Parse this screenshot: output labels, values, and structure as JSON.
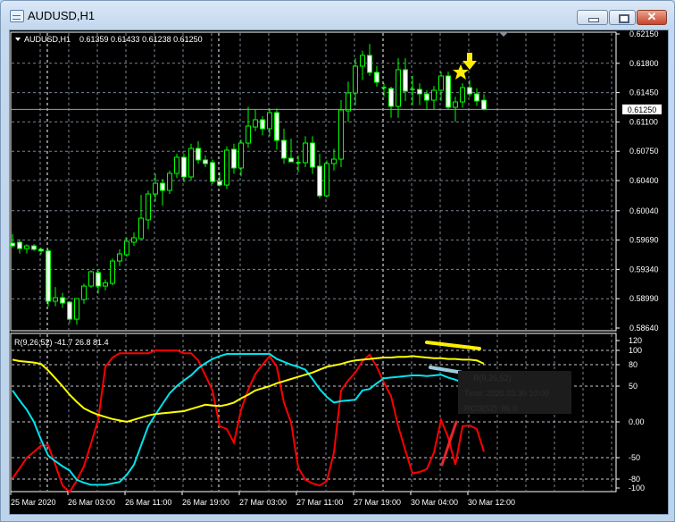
{
  "window": {
    "title": "AUDUSD,H1",
    "buttons": {
      "minimize": "minimize",
      "maximize": "maximize",
      "close": "✕"
    }
  },
  "header": {
    "symbol": "AUDUSD,H1",
    "ohlc": "0.61359 0.61433 0.61238 0.61250"
  },
  "colors": {
    "background": "#000000",
    "candle_outline": "#00ff00",
    "bull_fill": "#000000",
    "bear_fill": "#ffffff",
    "grid": "#7a8494",
    "rci_short": "#ff0000",
    "rci_mid": "#00e5ee",
    "rci_long": "#ffff00"
  },
  "price_axis": {
    "labels": [
      "0.62150",
      "0.61800",
      "0.61450",
      "0.61100",
      "0.60750",
      "0.60400",
      "0.60040",
      "0.59690",
      "0.59340",
      "0.58990",
      "0.58640"
    ],
    "current_price": "0.61250"
  },
  "time_axis": {
    "labels": [
      "25 Mar 2020",
      "26 Mar 03:00",
      "26 Mar 11:00",
      "26 Mar 19:00",
      "27 Mar 03:00",
      "27 Mar 11:00",
      "27 Mar 19:00",
      "30 Mar 04:00",
      "30 Mar 12:00"
    ]
  },
  "indicator": {
    "label": "R(9,26,52) -41.7 26.8 81.4",
    "levels": [
      "120",
      "100",
      "80",
      "50",
      "0.00",
      "-50",
      "-80",
      "-100"
    ],
    "tooltip": [
      "R(9,26,52)",
      "Time: 2020.03.30 10:00",
      "RCI3(52): 86.0"
    ]
  },
  "chart_data": {
    "type": "candlestick",
    "symbol": "AUDUSD",
    "timeframe": "H1",
    "ylim": [
      0.5864,
      0.6215
    ],
    "ohlc": [
      [
        0.59653,
        0.5976,
        0.596,
        0.59621
      ],
      [
        0.59664,
        0.597,
        0.5953,
        0.59589
      ],
      [
        0.59589,
        0.5964,
        0.5953,
        0.59621
      ],
      [
        0.59621,
        0.5964,
        0.5956,
        0.59579
      ],
      [
        0.59579,
        0.596,
        0.5952,
        0.5956
      ],
      [
        0.5956,
        0.5958,
        0.589,
        0.5896
      ],
      [
        0.5896,
        0.5913,
        0.589,
        0.59002
      ],
      [
        0.59002,
        0.5906,
        0.5888,
        0.58938
      ],
      [
        0.58949,
        0.5896,
        0.587,
        0.58746
      ],
      [
        0.58746,
        0.5898,
        0.5868,
        0.58992
      ],
      [
        0.58981,
        0.5917,
        0.5893,
        0.59141
      ],
      [
        0.59141,
        0.5933,
        0.5912,
        0.59312
      ],
      [
        0.59301,
        0.5933,
        0.5905,
        0.59141
      ],
      [
        0.59141,
        0.5922,
        0.5909,
        0.5918
      ],
      [
        0.59173,
        0.5947,
        0.5915,
        0.5944
      ],
      [
        0.5944,
        0.5958,
        0.5938,
        0.59525
      ],
      [
        0.59515,
        0.5972,
        0.5949,
        0.59675
      ],
      [
        0.59664,
        0.5978,
        0.5962,
        0.59717
      ],
      [
        0.59707,
        0.6023,
        0.597,
        0.59952
      ],
      [
        0.59931,
        0.6028,
        0.5982,
        0.6024
      ],
      [
        0.6024,
        0.6048,
        0.6015,
        0.60368
      ],
      [
        0.60368,
        0.6042,
        0.601,
        0.60283
      ],
      [
        0.60283,
        0.6052,
        0.6024,
        0.60486
      ],
      [
        0.60486,
        0.6072,
        0.6043,
        0.60678
      ],
      [
        0.60678,
        0.6072,
        0.6038,
        0.60443
      ],
      [
        0.60443,
        0.6084,
        0.604,
        0.60784
      ],
      [
        0.60784,
        0.6087,
        0.606,
        0.60646
      ],
      [
        0.60646,
        0.607,
        0.6056,
        0.60603
      ],
      [
        0.60614,
        0.6065,
        0.6036,
        0.60389
      ],
      [
        0.60389,
        0.605,
        0.6033,
        0.60347
      ],
      [
        0.60347,
        0.6081,
        0.603,
        0.60763
      ],
      [
        0.60774,
        0.6084,
        0.6048,
        0.6055
      ],
      [
        0.6055,
        0.6089,
        0.6045,
        0.60848
      ],
      [
        0.60848,
        0.6128,
        0.6079,
        0.61051
      ],
      [
        0.6104,
        0.6125,
        0.6099,
        0.61126
      ],
      [
        0.61126,
        0.6117,
        0.6094,
        0.61019
      ],
      [
        0.61019,
        0.6126,
        0.6093,
        0.61211
      ],
      [
        0.61211,
        0.6126,
        0.6077,
        0.6088
      ],
      [
        0.6088,
        0.6102,
        0.606,
        0.60667
      ],
      [
        0.60667,
        0.609,
        0.6062,
        0.60624
      ],
      [
        0.60614,
        0.607,
        0.605,
        0.60614
      ],
      [
        0.60614,
        0.6093,
        0.6056,
        0.60848
      ],
      [
        0.60848,
        0.6093,
        0.6048,
        0.6056
      ],
      [
        0.60571,
        0.6072,
        0.6019,
        0.60219
      ],
      [
        0.60219,
        0.6064,
        0.602,
        0.60603
      ],
      [
        0.60603,
        0.6078,
        0.6052,
        0.60656
      ],
      [
        0.60656,
        0.6136,
        0.6056,
        0.61243
      ],
      [
        0.61232,
        0.6158,
        0.611,
        0.61446
      ],
      [
        0.61446,
        0.6186,
        0.613,
        0.61766
      ],
      [
        0.61766,
        0.6195,
        0.616,
        0.61894
      ],
      [
        0.61894,
        0.6203,
        0.6165,
        0.61691
      ],
      [
        0.61691,
        0.6177,
        0.6152,
        0.61574
      ],
      [
        0.6151,
        0.6156,
        0.614,
        0.6151
      ],
      [
        0.61499,
        0.6152,
        0.6115,
        0.61286
      ],
      [
        0.61286,
        0.6186,
        0.6115,
        0.61723
      ],
      [
        0.61723,
        0.6186,
        0.6135,
        0.61467
      ],
      [
        0.61488,
        0.6165,
        0.613,
        0.61478
      ],
      [
        0.61488,
        0.6156,
        0.613,
        0.61435
      ],
      [
        0.61435,
        0.6148,
        0.6125,
        0.6136
      ],
      [
        0.6136,
        0.6153,
        0.6125,
        0.61478
      ],
      [
        0.61478,
        0.617,
        0.6135,
        0.61649
      ],
      [
        0.61649,
        0.617,
        0.6125,
        0.61275
      ],
      [
        0.61275,
        0.614,
        0.611,
        0.61339
      ],
      [
        0.61339,
        0.6156,
        0.6127,
        0.6151
      ],
      [
        0.6151,
        0.616,
        0.614,
        0.61435
      ],
      [
        0.61435,
        0.615,
        0.6129,
        0.6135
      ],
      [
        0.61359,
        0.61433,
        0.61238,
        0.6125
      ]
    ],
    "indicator": {
      "ylim": [
        -100,
        120
      ],
      "levels": [
        100,
        80,
        50,
        0,
        -50,
        -80
      ],
      "series": [
        {
          "color": "#ff0000",
          "values": [
            -79,
            -65,
            -50,
            -42,
            -33,
            -33,
            -60,
            -89,
            -98,
            -82,
            -62,
            -30,
            3,
            77,
            90,
            96,
            96,
            96,
            96,
            96,
            100,
            100,
            100,
            100,
            96,
            96,
            86,
            65,
            44,
            -6,
            -10,
            -29,
            17,
            45,
            67,
            80,
            92,
            77,
            27,
            -1,
            -64,
            -81,
            -86,
            -89,
            -83,
            -43,
            44,
            58,
            69,
            85,
            94,
            77,
            55,
            36,
            -6,
            -40,
            -72,
            -70,
            -66,
            -43,
            3,
            -22,
            -60,
            -6,
            -5,
            -10,
            -41.7
          ]
        },
        {
          "color": "#00e5ee",
          "values": [
            44,
            30,
            17,
            0,
            -25,
            -47,
            -55,
            -62,
            -68,
            -81,
            -85,
            -88,
            -88,
            -88,
            -86,
            -84,
            -74,
            -60,
            -33,
            -6,
            10,
            25,
            40,
            50,
            58,
            65,
            75,
            82,
            88,
            92,
            95,
            95,
            95,
            95,
            95,
            95,
            95,
            88,
            84,
            80,
            77,
            73,
            60,
            46,
            35,
            27,
            29,
            30,
            31,
            44,
            46,
            54,
            61,
            62,
            63,
            64,
            65,
            65,
            64,
            65,
            66,
            62,
            59,
            55,
            48,
            42,
            26.8
          ]
        },
        {
          "color": "#ffff00",
          "values": [
            87,
            85,
            84,
            83,
            81,
            72,
            61,
            50,
            38,
            28,
            19,
            14,
            10,
            7,
            4,
            2,
            0,
            3,
            6,
            9,
            11,
            12,
            13,
            14,
            15,
            18,
            21,
            24,
            23,
            22,
            24,
            27,
            33,
            38,
            44,
            47,
            50,
            54,
            57,
            60,
            63,
            66,
            69,
            73,
            77,
            79,
            81,
            84,
            86,
            87,
            88,
            89,
            90,
            90,
            91,
            91,
            92,
            91,
            90,
            89,
            89,
            88,
            88,
            87,
            87,
            86,
            81.4
          ]
        }
      ]
    }
  }
}
